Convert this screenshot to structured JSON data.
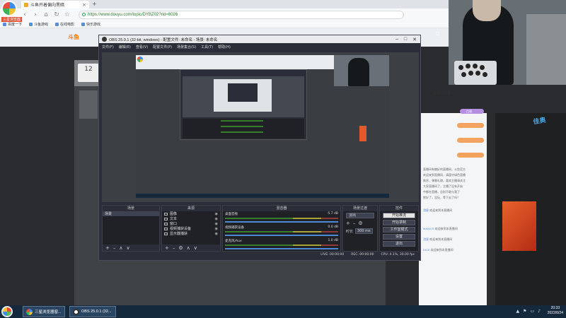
{
  "browser": {
    "brand_label": "三星浏览器",
    "tab_title": "斗鱼开着偏向黑暗",
    "url": "https://www.douyu.com/topic/DYBZ02?rid=6026",
    "nav": {
      "back": "‹",
      "forward": "›",
      "home": "⌂",
      "refresh": "↻",
      "favorite": "☆"
    },
    "bookmarks": [
      "百度一下",
      "斗鱼游戏",
      "在线电影",
      "快乐游戏"
    ],
    "zoom_control": "▢"
  },
  "site": {
    "logo": "斗鱼",
    "follower_count": "12",
    "chat": {
      "header": "直播间公告",
      "level_badge": "白银",
      "lines": [
        "直播间有偏好的直播间，斗鱼官方",
        "欢迎来到直播间，请遵守绿色直播",
        "秩序，弹幕礼貌，喜欢主播请关注",
        "大家直播间了，主播了没有开始",
        "中都在直播，告别不敢与我了",
        "那好了，没玩，等下去了吗？"
      ],
      "messages": [
        {
          "user": "游客",
          "text": "欢迎来到本直播间"
        },
        {
          "user": "MAWLIS",
          "text": "欢迎来到本直播间"
        },
        {
          "user": "游客",
          "text": "欢迎来到本直播间"
        },
        {
          "user": "DICE",
          "text": "欢迎来到本直播间"
        }
      ]
    },
    "gift_logo": "佳奥"
  },
  "obs": {
    "title": "OBS 25.0.1 (32-bit, windows) - 配置文件: 未命名 - 场景: 未命名",
    "menu": [
      "文件(F)",
      "编辑(E)",
      "查看(V)",
      "配置文件(P)",
      "场景集合(S)",
      "工具(T)",
      "帮助(H)"
    ],
    "window_controls": {
      "minimize": "–",
      "maximize": "□",
      "close": "✕"
    },
    "docks": {
      "scenes": {
        "title": "场景",
        "items": [
          "场景"
        ]
      },
      "sources": {
        "title": "来源",
        "items": [
          "图像",
          "文本",
          "窗口",
          "视频捕获设备",
          "显示器捕获"
        ]
      },
      "mixer": {
        "title": "混音器",
        "channels": [
          {
            "name": "桌面音频",
            "db": "-5.7 dB"
          },
          {
            "name": "视频捕获设备",
            "db": "0.0 dB"
          },
          {
            "name": "麦克风/Aux",
            "db": "1.0 dB"
          }
        ]
      },
      "transitions": {
        "title": "场景过渡",
        "type": "淡出",
        "duration_label": "时长",
        "duration": "300 ms"
      },
      "controls": {
        "title": "控件",
        "buttons": [
          "开始推流",
          "开始录制",
          "工作室模式",
          "设置",
          "退出"
        ]
      }
    },
    "status": {
      "live": "LIVE: 00:00:00",
      "rec": "REC: 00:00:00",
      "cpu": "CPU: 4.1%, 30.00 fps"
    },
    "foot_icons": "+ – ∧ ∨"
  },
  "taskbar": {
    "tasks": [
      "三星浏览器窗...",
      "OBS 25.0.1 (32..."
    ],
    "tray": [
      "▲",
      "⚑",
      "▭",
      "♪"
    ],
    "time": "20:33",
    "date": "2022/6/24"
  },
  "colors": {
    "accent": "#ff7a00",
    "obs_bg": "#2b2e38",
    "dock_bg": "#1f2127",
    "taskbar": "#15293d",
    "url_green": "#2e7d32",
    "stream_button": "#e4e4e4"
  }
}
